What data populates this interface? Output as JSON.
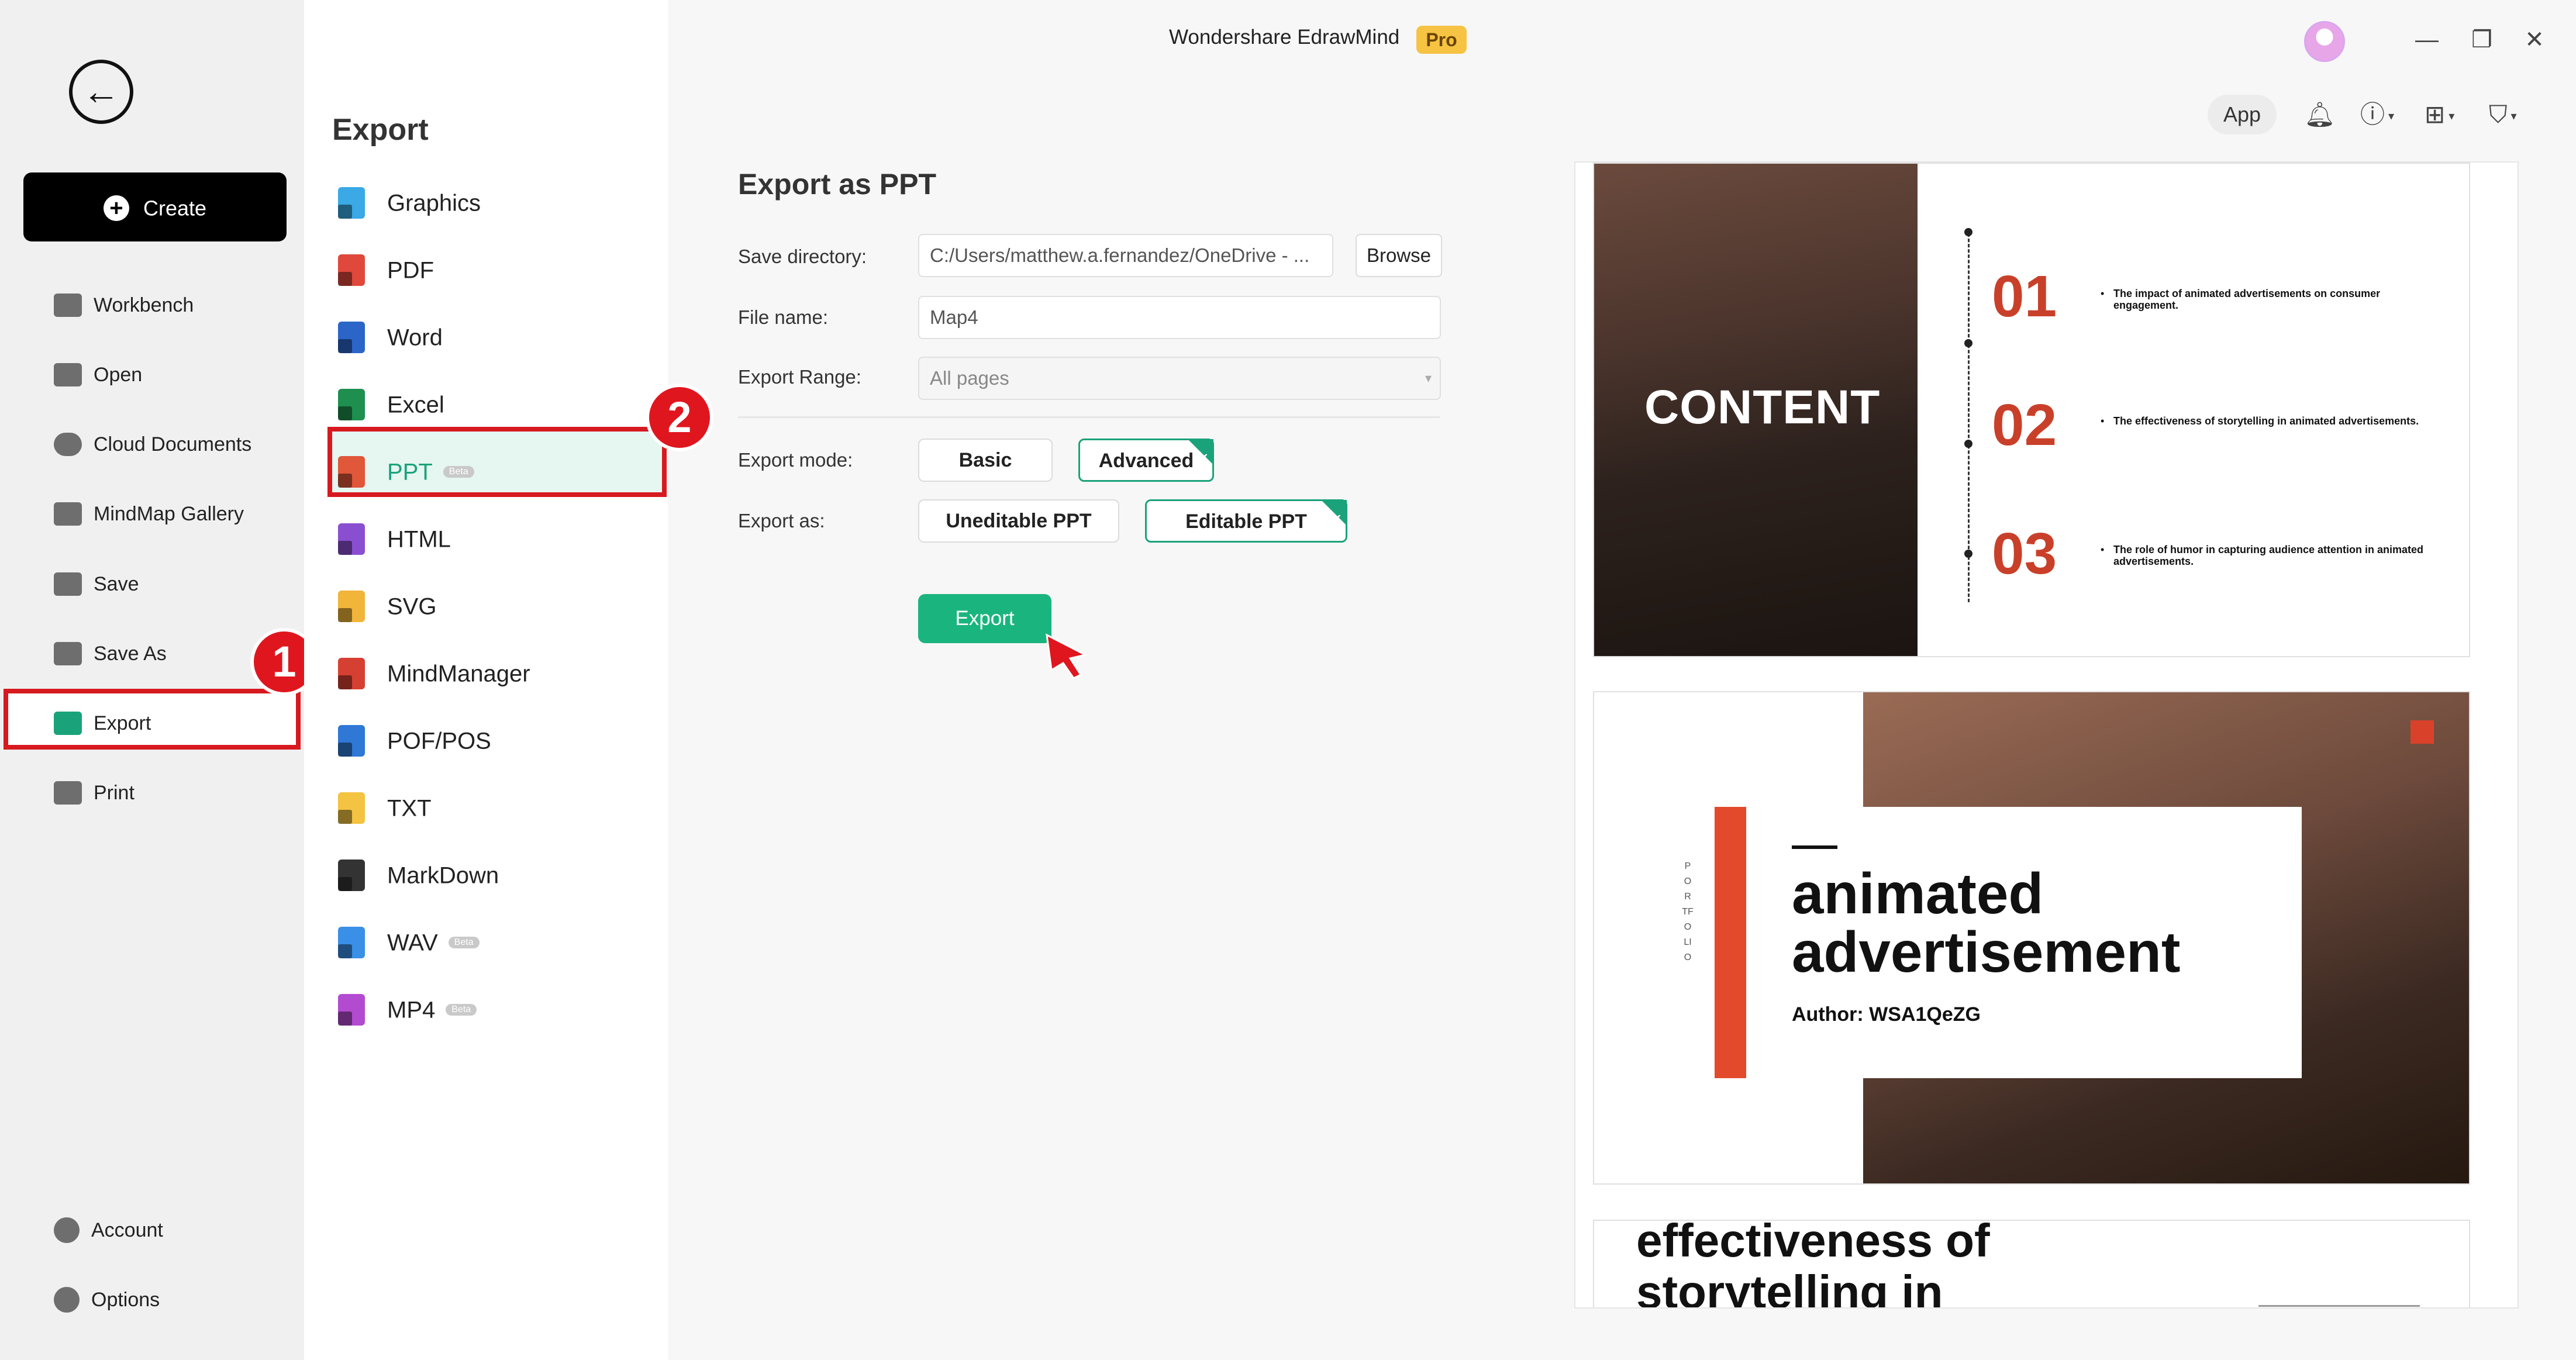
{
  "window": {
    "title": "Wondershare EdrawMind",
    "badge": "Pro",
    "controls": {
      "minimize": "—",
      "restore": "❐",
      "close": "✕"
    }
  },
  "toolbar": {
    "app_label": "App",
    "icons": [
      "bell-icon",
      "help-icon",
      "apps-grid-icon",
      "shirt-icon"
    ]
  },
  "left_nav": {
    "back_icon": "arrow-left-icon",
    "create_label": "Create",
    "items": [
      {
        "label": "Workbench",
        "icon": "workbench-icon"
      },
      {
        "label": "Open",
        "icon": "folder-icon"
      },
      {
        "label": "Cloud Documents",
        "icon": "cloud-icon"
      },
      {
        "label": "MindMap Gallery",
        "icon": "gallery-icon"
      },
      {
        "label": "Save",
        "icon": "save-icon"
      },
      {
        "label": "Save As",
        "icon": "save-as-icon"
      },
      {
        "label": "Export",
        "icon": "export-icon",
        "selected": true
      },
      {
        "label": "Print",
        "icon": "print-icon"
      }
    ],
    "bottom_items": [
      {
        "label": "Account",
        "icon": "account-icon"
      },
      {
        "label": "Options",
        "icon": "gear-icon"
      }
    ]
  },
  "callouts": {
    "one": "1",
    "two": "2"
  },
  "formats": {
    "title": "Export",
    "items": [
      {
        "label": "Graphics",
        "color": "#3aa9e6"
      },
      {
        "label": "PDF",
        "color": "#e0483c"
      },
      {
        "label": "Word",
        "color": "#2b65c8"
      },
      {
        "label": "Excel",
        "color": "#1e8f4e"
      },
      {
        "label": "PPT",
        "color": "#e0573a",
        "beta": "Beta",
        "selected": true
      },
      {
        "label": "HTML",
        "color": "#8a4fd1"
      },
      {
        "label": "SVG",
        "color": "#f1b53a"
      },
      {
        "label": "MindManager",
        "color": "#d64032"
      },
      {
        "label": "POF/POS",
        "color": "#2f78d6"
      },
      {
        "label": "TXT",
        "color": "#f3c341"
      },
      {
        "label": "MarkDown",
        "color": "#333333"
      },
      {
        "label": "WAV",
        "color": "#3a8fe6",
        "beta": "Beta"
      },
      {
        "label": "MP4",
        "color": "#b34bd0",
        "beta": "Beta"
      }
    ]
  },
  "main": {
    "title": "Export as PPT",
    "save_directory_label": "Save directory:",
    "save_directory_value": "C:/Users/matthew.a.fernandez/OneDrive - ...",
    "browse_label": "Browse",
    "file_name_label": "File name:",
    "file_name_value": "Map4",
    "export_range_label": "Export Range:",
    "export_range_value": "All pages",
    "export_mode_label": "Export mode:",
    "mode_basic": "Basic",
    "mode_advanced": "Advanced",
    "export_as_label": "Export as:",
    "as_uneditable": "Uneditable PPT",
    "as_editable": "Editable PPT",
    "export_button": "Export"
  },
  "preview": {
    "slide1": {
      "heading": "CONTENT",
      "items": [
        {
          "num": "01",
          "text": "The impact of animated advertisements on consumer engagement."
        },
        {
          "num": "02",
          "text": "The effectiveness of storytelling in animated advertisements."
        },
        {
          "num": "03",
          "text": "The role of humor in capturing audience attention in animated advertisements."
        }
      ]
    },
    "slide2": {
      "title_line1": "animated",
      "title_line2": "advertisement",
      "author": "Author: WSA1QeZG",
      "vertical": "PORTFOLIO"
    },
    "slide3": {
      "line1": "effectiveness of",
      "line2": "storytelling in"
    }
  }
}
